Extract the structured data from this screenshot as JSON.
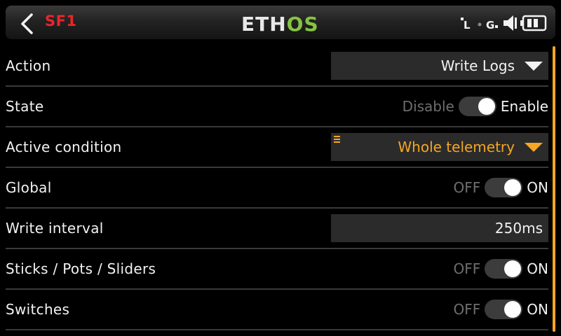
{
  "header": {
    "title": "SF1",
    "logo_left": "ETH",
    "logo_right": "OS",
    "status": {
      "l_label": "L",
      "g_label": "G"
    }
  },
  "rows": [
    {
      "label": "Action",
      "value": "Write Logs"
    },
    {
      "label": "State",
      "off": "Disable",
      "on": "Enable"
    },
    {
      "label": "Active condition",
      "value": "Whole telemetry"
    },
    {
      "label": "Global",
      "off": "OFF",
      "on": "ON"
    },
    {
      "label": "Write interval",
      "value": "250ms"
    },
    {
      "label": "Sticks / Pots / Sliders",
      "off": "OFF",
      "on": "ON"
    },
    {
      "label": "Switches",
      "off": "OFF",
      "on": "ON"
    }
  ],
  "colors": {
    "accent": "#f5a623",
    "title_red": "#e8262b",
    "logo_green": "#86c440"
  }
}
